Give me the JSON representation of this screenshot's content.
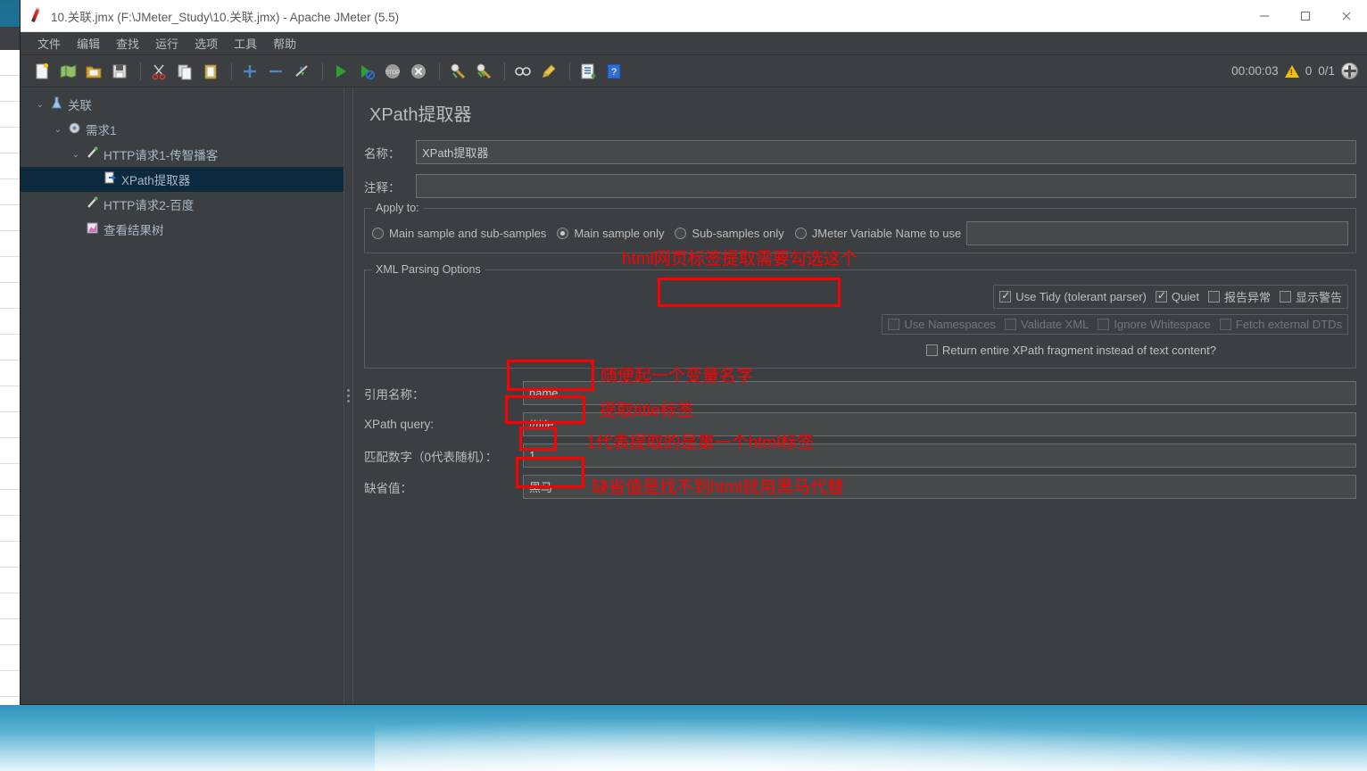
{
  "window": {
    "title": "10.关联.jmx (F:\\JMeter_Study\\10.关联.jmx) - Apache JMeter (5.5)",
    "app_icon": "jmeter-pen-icon",
    "minimize": "−",
    "maximize": "□",
    "close": "✕"
  },
  "menubar": {
    "items": [
      {
        "label": "文件",
        "name": "menu-file"
      },
      {
        "label": "编辑",
        "name": "menu-edit"
      },
      {
        "label": "查找",
        "name": "menu-search"
      },
      {
        "label": "运行",
        "name": "menu-run"
      },
      {
        "label": "选项",
        "name": "menu-options"
      },
      {
        "label": "工具",
        "name": "menu-tools"
      },
      {
        "label": "帮助",
        "name": "menu-help"
      }
    ]
  },
  "toolbar": {
    "buttons": [
      {
        "icon": "📄",
        "name": "new-icon"
      },
      {
        "icon": "🗺",
        "name": "templates-icon"
      },
      {
        "icon": "📂",
        "name": "open-icon"
      },
      {
        "icon": "💾",
        "name": "save-icon"
      },
      {
        "sep": true
      },
      {
        "icon": "✂",
        "name": "cut-icon"
      },
      {
        "icon": "📋",
        "name": "copy-icon"
      },
      {
        "icon": "📝",
        "name": "paste-icon"
      },
      {
        "sep": true
      },
      {
        "icon": "+",
        "name": "expand-all-icon"
      },
      {
        "icon": "−",
        "name": "collapse-all-icon"
      },
      {
        "icon": "⚡",
        "name": "toggle-icon"
      },
      {
        "sep": true
      },
      {
        "icon": "▶",
        "name": "start-icon"
      },
      {
        "icon": "▶",
        "name": "start-no-timers-icon"
      },
      {
        "icon": "⏹",
        "name": "stop-icon"
      },
      {
        "icon": "✖",
        "name": "shutdown-icon"
      },
      {
        "sep": true
      },
      {
        "icon": "🧹",
        "name": "clear-icon"
      },
      {
        "icon": "🧹",
        "name": "clear-all-icon"
      },
      {
        "sep": true
      },
      {
        "icon": "🔍",
        "name": "search-icon"
      },
      {
        "icon": "🖌",
        "name": "reset-search-icon"
      },
      {
        "sep": true
      },
      {
        "icon": "📃",
        "name": "function-helper-icon"
      },
      {
        "icon": "❓",
        "name": "help-icon"
      }
    ],
    "timer": "00:00:03",
    "warning_count": "0",
    "thread_count": "0/1",
    "globe": "globe-icon"
  },
  "tree": {
    "items": [
      {
        "name": "tree-item-test-plan",
        "label": "关联",
        "icon": "🔬",
        "depth": 0,
        "twisty": "⌄",
        "selected": false
      },
      {
        "name": "tree-item-thread-group",
        "label": "需求1",
        "icon": "⚙",
        "depth": 1,
        "twisty": "⌄",
        "selected": false
      },
      {
        "name": "tree-item-http-1",
        "label": "HTTP请求1-传智播客",
        "icon": "🖊",
        "depth": 2,
        "twisty": "⌄",
        "selected": false
      },
      {
        "name": "tree-item-xpath-extractor",
        "label": "XPath提取器",
        "icon": "📄",
        "depth": 3,
        "twisty": "",
        "selected": true
      },
      {
        "name": "tree-item-http-2",
        "label": "HTTP请求2-百度",
        "icon": "🖊",
        "depth": 2,
        "twisty": "",
        "selected": false
      },
      {
        "name": "tree-item-view-results",
        "label": "查看结果树",
        "icon": "📊",
        "depth": 2,
        "twisty": "",
        "selected": false
      }
    ]
  },
  "main": {
    "title": "XPath提取器",
    "name_label": "名称：",
    "name_value": "XPath提取器",
    "comment_label": "注释：",
    "comment_value": "",
    "apply_to": {
      "legend": "Apply to:",
      "options": [
        {
          "label": "Main sample and sub-samples",
          "checked": false,
          "name": "radio-main-and-sub"
        },
        {
          "label": "Main sample only",
          "checked": true,
          "name": "radio-main-only"
        },
        {
          "label": "Sub-samples only",
          "checked": false,
          "name": "radio-sub-only"
        },
        {
          "label": "JMeter Variable Name to use",
          "checked": false,
          "name": "radio-jmeter-variable"
        }
      ],
      "variable_value": ""
    },
    "xml_parsing": {
      "legend": "XML Parsing Options",
      "row1": [
        {
          "label": "Use Tidy (tolerant parser)",
          "checked": true,
          "enabled": true,
          "name": "checkbox-use-tidy"
        },
        {
          "label": "Quiet",
          "checked": true,
          "enabled": true,
          "name": "checkbox-quiet"
        },
        {
          "label": "报告异常",
          "checked": false,
          "enabled": true,
          "name": "checkbox-report-errors"
        },
        {
          "label": "显示警告",
          "checked": false,
          "enabled": true,
          "name": "checkbox-show-warnings"
        }
      ],
      "row2": [
        {
          "label": "Use Namespaces",
          "checked": false,
          "enabled": false,
          "name": "checkbox-use-namespaces"
        },
        {
          "label": "Validate XML",
          "checked": false,
          "enabled": false,
          "name": "checkbox-validate-xml"
        },
        {
          "label": "Ignore Whitespace",
          "checked": false,
          "enabled": false,
          "name": "checkbox-ignore-whitespace"
        },
        {
          "label": "Fetch external DTDs",
          "checked": false,
          "enabled": false,
          "name": "checkbox-fetch-external-dtds"
        }
      ],
      "fragment": {
        "label": "Return entire XPath fragment instead of text content?",
        "checked": false,
        "name": "checkbox-return-fragment"
      }
    },
    "fields": [
      {
        "label": "引用名称：",
        "value": "name",
        "name": "reference-name"
      },
      {
        "label": "XPath query:",
        "value": "//title",
        "name": "xpath-query"
      },
      {
        "label": "匹配数字（0代表随机）：",
        "value": "1",
        "name": "match-number"
      },
      {
        "label": "缺省值：",
        "value": "黑马",
        "name": "default-value"
      }
    ]
  },
  "annotations": [
    {
      "text": "html网页标签提取需要勾选这个",
      "name": "annotation-use-tidy"
    },
    {
      "text": "随便起一个变量名字",
      "name": "annotation-reference-name"
    },
    {
      "text": "提取title标签",
      "name": "annotation-xpath-query"
    },
    {
      "text": "1代表提取的是第一个html标签",
      "name": "annotation-match-number"
    },
    {
      "text": "缺省值是找不到html就用黑马代替",
      "name": "annotation-default-value"
    }
  ],
  "colors": {
    "annotation_red": "#ff0000",
    "panel_bg": "#3c3f41",
    "selection_blue": "#0d293e",
    "text": "#bbbbbb"
  }
}
